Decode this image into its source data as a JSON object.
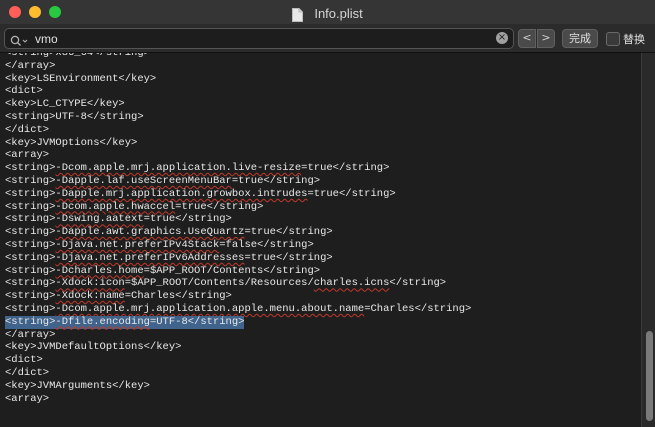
{
  "window": {
    "title": "Info.plist"
  },
  "find_bar": {
    "query": "vmo",
    "done_label": "完成",
    "replace_label": "替换",
    "prev_label": "<",
    "next_label": ">",
    "clear_label": "×"
  },
  "editor": {
    "lines": [
      [
        "<string>x86_64</string>"
      ],
      [
        "</array>"
      ],
      [
        "<key>LSEnvironment</key>"
      ],
      [
        "<dict>"
      ],
      [
        "<key>LC_CTYPE</key>"
      ],
      [
        "<string>UTF-8</string>"
      ],
      [
        "</dict>"
      ],
      [
        "<key>JVMOptions</key>"
      ],
      [
        "<array>"
      ],
      [
        "<string>",
        "-Dcom.apple.mrj.application.live-resize",
        "=true</string>"
      ],
      [
        "<string>",
        "-Dapple.laf.useScreenMenuBar",
        "=true</string>"
      ],
      [
        "<string>",
        "-Dapple.mrj.application.growbox.intrudes",
        "=true</string>"
      ],
      [
        "<string>",
        "-Dcom.apple.hwaccel",
        "=true</string>"
      ],
      [
        "<string>",
        "-Dswing.aatext",
        "=true</string>"
      ],
      [
        "<string>",
        "-Dapple.awt.graphics.UseQuartz",
        "=true</string>"
      ],
      [
        "<string>",
        "-Djava.net.preferIPv4Stack",
        "=false</string>"
      ],
      [
        "<string>",
        "-Djava.net.preferIPv6Addresses",
        "=true</string>"
      ],
      [
        "<string>",
        "-Dcharles.home",
        "=$APP_ROOT/Contents</string>"
      ],
      [
        "<string>",
        "-Xdock:icon",
        "=$APP_ROOT/Contents/Resources/",
        "charles.icns",
        "</string>"
      ],
      [
        "<string>",
        "-Xdock:name",
        "=Charles</string>"
      ],
      [
        "<string>",
        "-Dcom.apple.mrj.application.apple.menu.about.name",
        "=Charles</string>"
      ],
      [
        "<string>",
        "-Dfile.encoding",
        "=UTF-8</string>"
      ],
      [
        "</array>"
      ],
      [
        "<key>JVMDefaultOptions</key>"
      ],
      [
        "<dict>"
      ],
      [
        "</dict>"
      ],
      [
        "<key>JVMArguments</key>"
      ],
      [
        "<array>"
      ]
    ],
    "selected_line": 21
  },
  "colors": {
    "selection": "#3f638b",
    "close": "#ff5f57",
    "minimize": "#febc2e",
    "maximize": "#28c840",
    "spelling_underline": "#c0392b"
  },
  "icons": [
    "document-icon",
    "search-icon",
    "clear-icon"
  ]
}
